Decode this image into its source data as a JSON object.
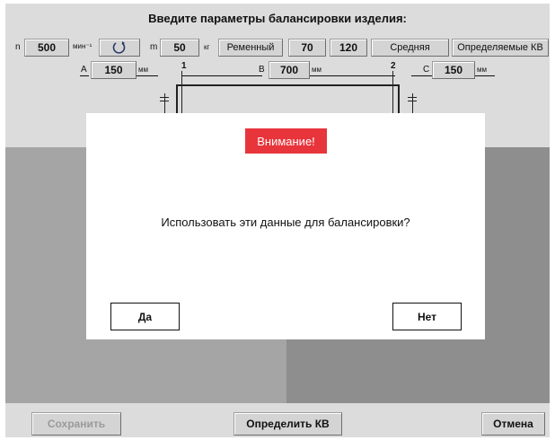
{
  "header": {
    "title": "Введите параметры балансировки изделия:"
  },
  "params": {
    "n_label": "n",
    "n_value": "500",
    "n_unit": "мин⁻¹",
    "rotation_icon": "rotate-ccw-icon",
    "m_label": "m",
    "m_value": "50",
    "m_unit": "кг",
    "drive_type": "Ременный",
    "value_70": "70",
    "value_120": "120",
    "mode": "Средняя",
    "kv_mode": "Определяемые КВ"
  },
  "dimensions": {
    "a_label": "A",
    "a_value": "150",
    "a_unit": "мм",
    "b_label": "B",
    "b_value": "700",
    "b_unit": "мм",
    "c_label": "C",
    "c_value": "150",
    "c_unit": "мм",
    "plane1": "1",
    "plane2": "2"
  },
  "footer": {
    "save": "Сохранить",
    "determine_kv": "Определить КВ",
    "cancel": "Отмена"
  },
  "dialog": {
    "title": "Внимание!",
    "message": "Использовать эти данные для балансировки?",
    "yes": "Да",
    "no": "Нет"
  },
  "colors": {
    "background": "#dcdcdc",
    "dialog_title_bg": "#e8343b",
    "panel_left": "#a5a5a5",
    "panel_right": "#8e8e8e"
  }
}
